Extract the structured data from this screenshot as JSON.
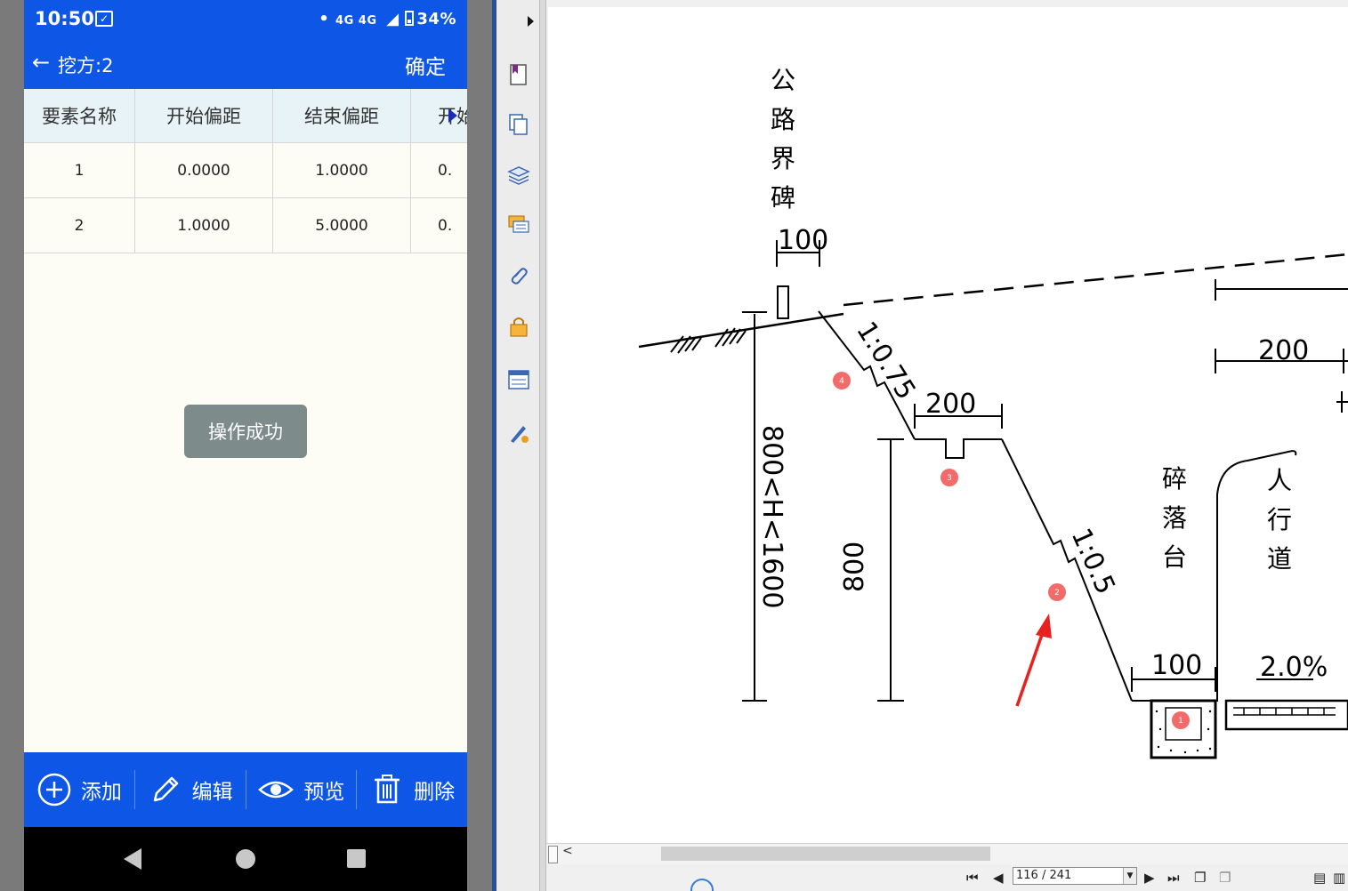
{
  "status_bar": {
    "time": "10:50",
    "network": "4G 4G",
    "battery": "34%"
  },
  "app_bar": {
    "back_icon": "arrow-left-icon",
    "title": "挖方:2",
    "confirm": "确定"
  },
  "table": {
    "headers": [
      "要素名称",
      "开始偏距",
      "结束偏距",
      "开始"
    ],
    "rows": [
      [
        "1",
        "0.0000",
        "1.0000",
        "0."
      ],
      [
        "2",
        "1.0000",
        "5.0000",
        "0."
      ]
    ]
  },
  "toast": "操作成功",
  "bottom_bar": {
    "add": "添加",
    "edit": "编辑",
    "preview": "预览",
    "delete": "删除"
  },
  "drawing": {
    "boundary_marker": [
      "公",
      "路",
      "界",
      "碑"
    ],
    "dim_100_top": "100",
    "slope_1": "1:0.75",
    "dim_200_mid": "200",
    "dim_height": "800<H<1600",
    "dim_800": "800",
    "slope_2": "1:0.5",
    "rockfall": [
      "碎",
      "落",
      "台"
    ],
    "sidewalk": [
      "人",
      "行",
      "道"
    ],
    "dim_200_right": "200",
    "dim_100_bottom": "100",
    "grade": "2.0%",
    "markers": [
      "4",
      "3",
      "2",
      "1"
    ]
  },
  "pdf_nav": {
    "page": "116 / 241"
  },
  "colors": {
    "accent": "#0d56e6",
    "marker": "#f26b6b",
    "arrow": "#e82020"
  }
}
